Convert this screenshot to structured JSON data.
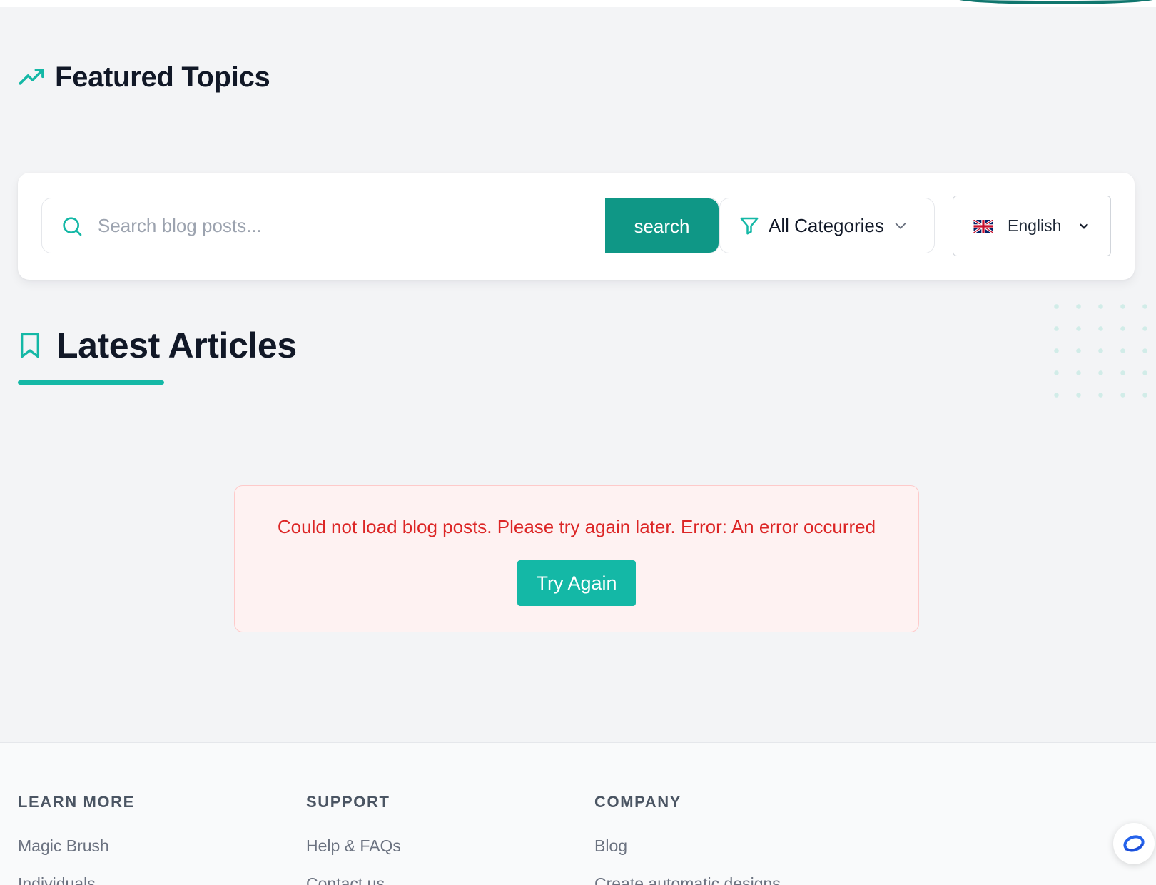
{
  "featured": {
    "title": "Featured Topics"
  },
  "search": {
    "placeholder": "Search blog posts...",
    "button_label": "search"
  },
  "category_filter": {
    "selected": "All Categories"
  },
  "language_select": {
    "selected": "English"
  },
  "latest": {
    "title": "Latest Articles"
  },
  "error": {
    "message": "Could not load blog posts. Please try again later. Error: An error occurred",
    "retry_label": "Try Again"
  },
  "footer": {
    "columns": [
      {
        "heading": "LEARN MORE",
        "links": [
          "Magic Brush",
          "Individuals"
        ]
      },
      {
        "heading": "SUPPORT",
        "links": [
          "Help & FAQs",
          "Contact us"
        ]
      },
      {
        "heading": "COMPANY",
        "links": [
          "Blog",
          "Create automatic designs"
        ]
      }
    ]
  },
  "icons": {
    "featured": "trending-up-icon",
    "latest": "bookmark-icon",
    "search": "search-icon",
    "filter": "filter-icon",
    "flag": "uk-flag-icon",
    "help": "chat-help-icon"
  },
  "colors": {
    "accent": "#14b8a6",
    "accent_dark": "#0f9786",
    "error_text": "#dc2626",
    "error_bg": "#fef2f2",
    "page_bg": "#f3f4f6"
  }
}
